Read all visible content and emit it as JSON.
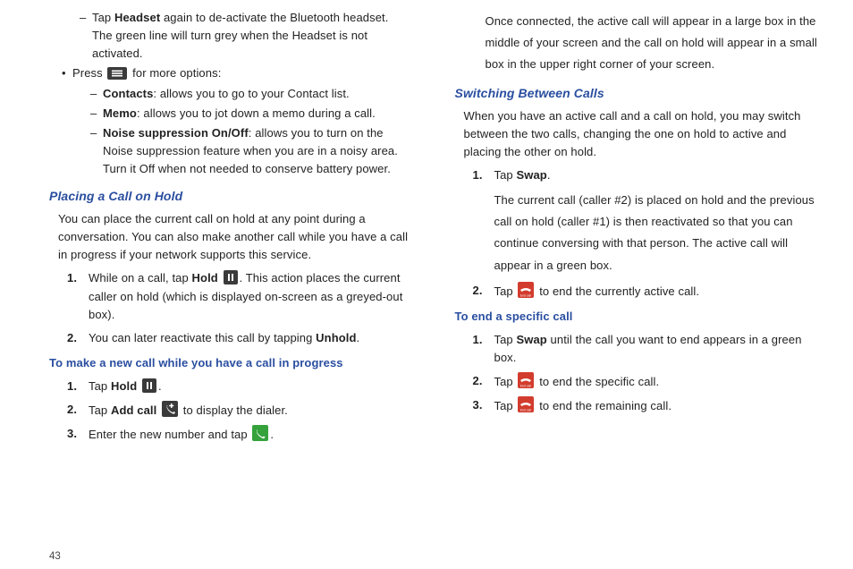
{
  "pageNumber": "43",
  "left": {
    "intro": {
      "dash1": {
        "pre": "Tap ",
        "bold": "Headset",
        "post": " again to de-activate the Bluetooth headset. The green line will turn grey when the Headset is not activated."
      },
      "bullet1": {
        "pre": "Press ",
        "post": " for more options:"
      },
      "dash2a": {
        "bold": "Contacts",
        "post": ": allows you to go to your Contact list."
      },
      "dash2b": {
        "bold": "Memo",
        "post": ": allows you to jot down a memo during a call."
      },
      "dash2c": {
        "bold": "Noise suppression On/Off",
        "post": ": allows you to turn on the Noise suppression feature when you are in a noisy area. Turn it Off when not needed to conserve battery power."
      }
    },
    "hold": {
      "heading": "Placing a Call on Hold",
      "para": "You can place the current call on hold at any point during a conversation. You can also make another call while you have a call in progress if your network supports this service.",
      "step1": {
        "m": "1.",
        "pre": "While on a call, tap ",
        "bold": "Hold",
        "post1": " ",
        "post2": ". This action places the current caller on hold (which is displayed on-screen as a greyed-out box)."
      },
      "step2": {
        "m": "2.",
        "pre": "You can later reactivate this call by tapping ",
        "bold": "Unhold",
        "post": "."
      }
    },
    "newcall": {
      "heading": "To make a new call while you have a call in progress",
      "step1": {
        "m": "1.",
        "pre": "Tap ",
        "bold": "Hold",
        "post": " "
      },
      "step2": {
        "m": "2.",
        "pre": "Tap ",
        "bold": "Add call",
        "post1": " ",
        "post2": " to display the dialer."
      },
      "step3": {
        "m": "3.",
        "pre": "Enter the new number and tap ",
        "post": "."
      }
    }
  },
  "right": {
    "topPara": "Once connected, the active call will appear in a large box in the middle of your screen and the call on hold will appear in a small box in the upper right corner of your screen.",
    "switch": {
      "heading": "Switching Between Calls",
      "para": "When you have an active call and a call on hold, you may switch between the two calls, changing the one on hold to active and placing the other on hold.",
      "step1": {
        "m": "1.",
        "pre": "Tap ",
        "bold": "Swap",
        "post": ".",
        "detail": "The current call (caller #2) is placed on hold and the previous call on hold (caller #1) is then reactivated so that you can continue conversing with that person. The active call will appear in a green box."
      },
      "step2": {
        "m": "2.",
        "pre": "Tap ",
        "post": " to end the currently active call."
      }
    },
    "endspecific": {
      "heading": "To end a specific call",
      "step1": {
        "m": "1.",
        "pre": "Tap ",
        "bold": "Swap",
        "post": " until the call you want to end appears in a green box."
      },
      "step2": {
        "m": "2.",
        "pre": "Tap ",
        "post": " to end the specific call."
      },
      "step3": {
        "m": "3.",
        "pre": "Tap ",
        "post": " to end the remaining call."
      }
    }
  }
}
